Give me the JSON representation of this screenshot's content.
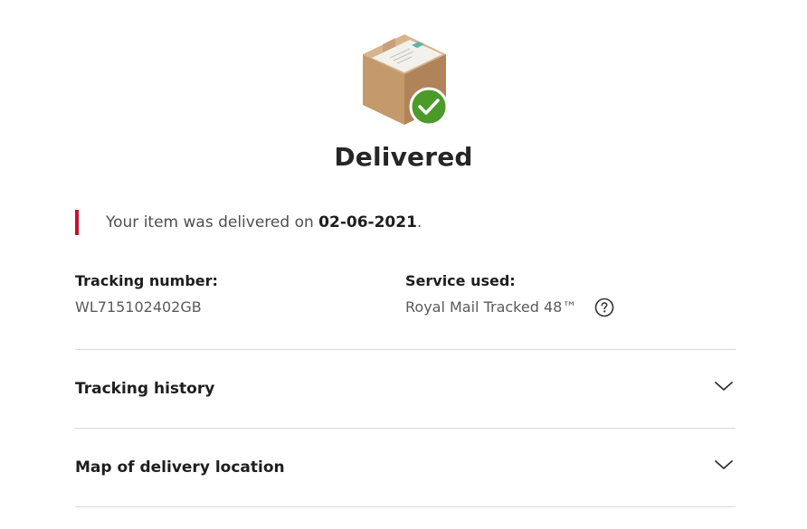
{
  "status": {
    "icon": "package-delivered-icon",
    "title": "Delivered"
  },
  "notice": {
    "prefix": "Your item was delivered on ",
    "date": "02-06-2021",
    "suffix": "."
  },
  "tracking": {
    "label": "Tracking number:",
    "value": "WL715102402GB"
  },
  "service": {
    "label": "Service used:",
    "value": "Royal Mail Tracked 48™",
    "help_icon": "question-circle-icon"
  },
  "sections": [
    {
      "label": "Tracking history",
      "icon": "chevron-down-icon"
    },
    {
      "label": "Map of delivery location",
      "icon": "chevron-down-icon"
    }
  ],
  "colors": {
    "accent_red": "#c8102e",
    "success_green": "#4c9a2a",
    "box_brown": "#c9a27a"
  }
}
